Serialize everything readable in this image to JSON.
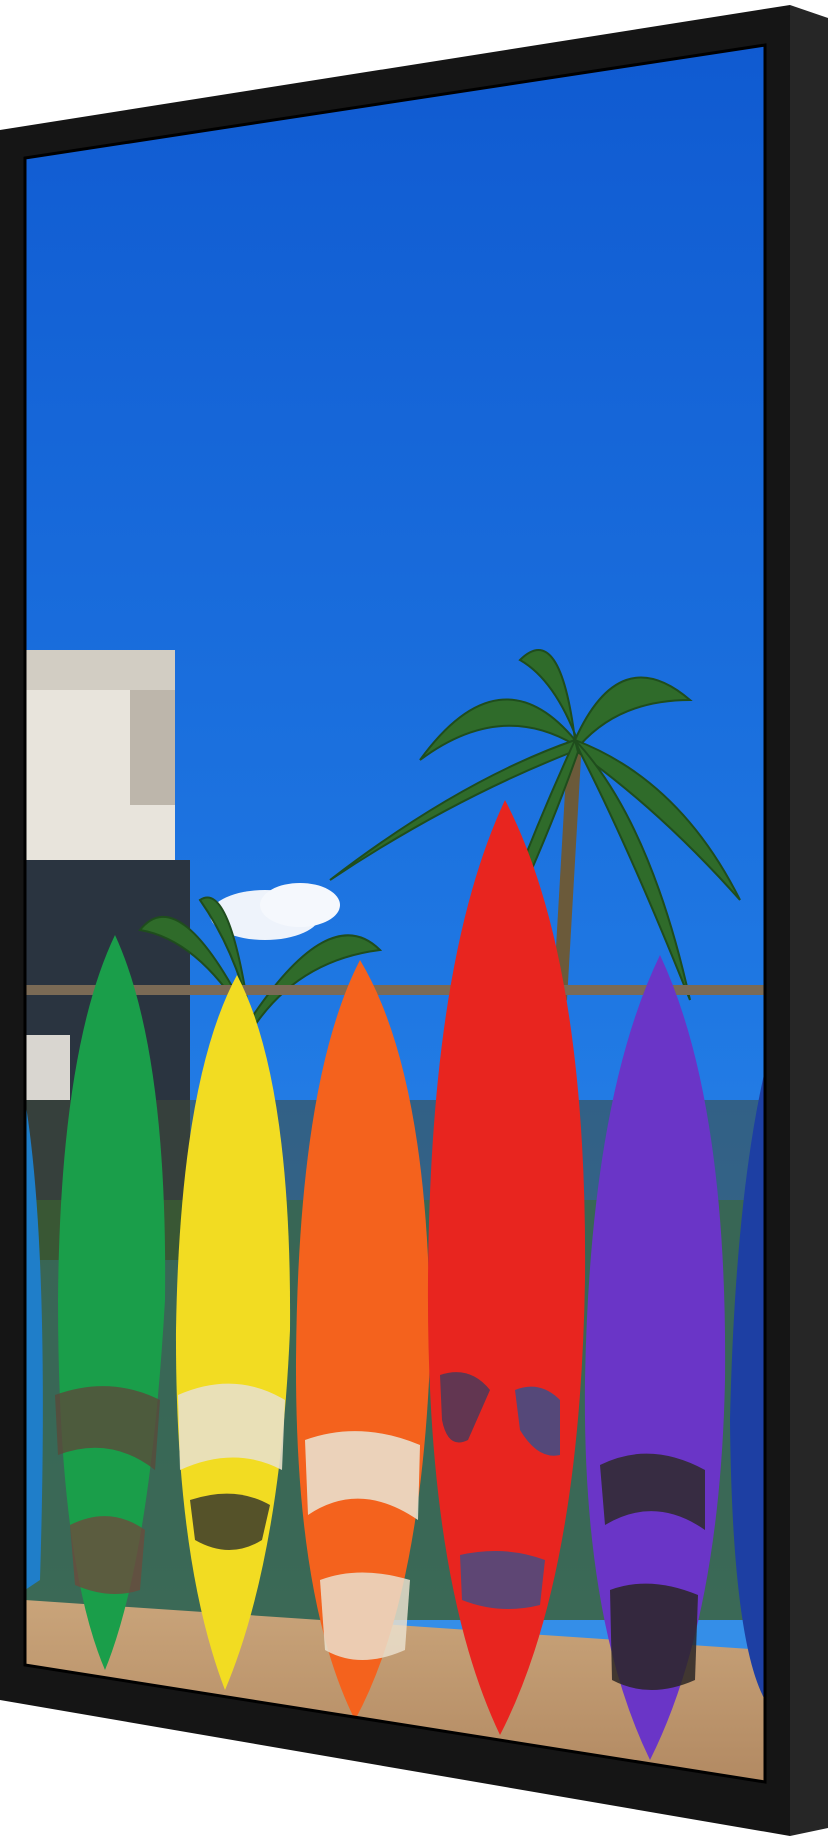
{
  "product": {
    "kind": "portrait digital signage display",
    "frame_color": "#1b1b1b",
    "bezel_color": "#0d0d0d"
  },
  "screen_content": {
    "sky_color_top": "#1462d6",
    "sky_color_bottom": "#2f8be8",
    "surfboards": [
      {
        "color": "#1a9e4a",
        "label": "green-board"
      },
      {
        "color": "#f2dc22",
        "label": "yellow-board"
      },
      {
        "color": "#f4621d",
        "label": "orange-board"
      },
      {
        "color": "#e8251f",
        "label": "red-board"
      },
      {
        "color": "#6a35c7",
        "label": "purple-board"
      },
      {
        "color": "#1d3fa3",
        "label": "blue-board"
      }
    ]
  }
}
